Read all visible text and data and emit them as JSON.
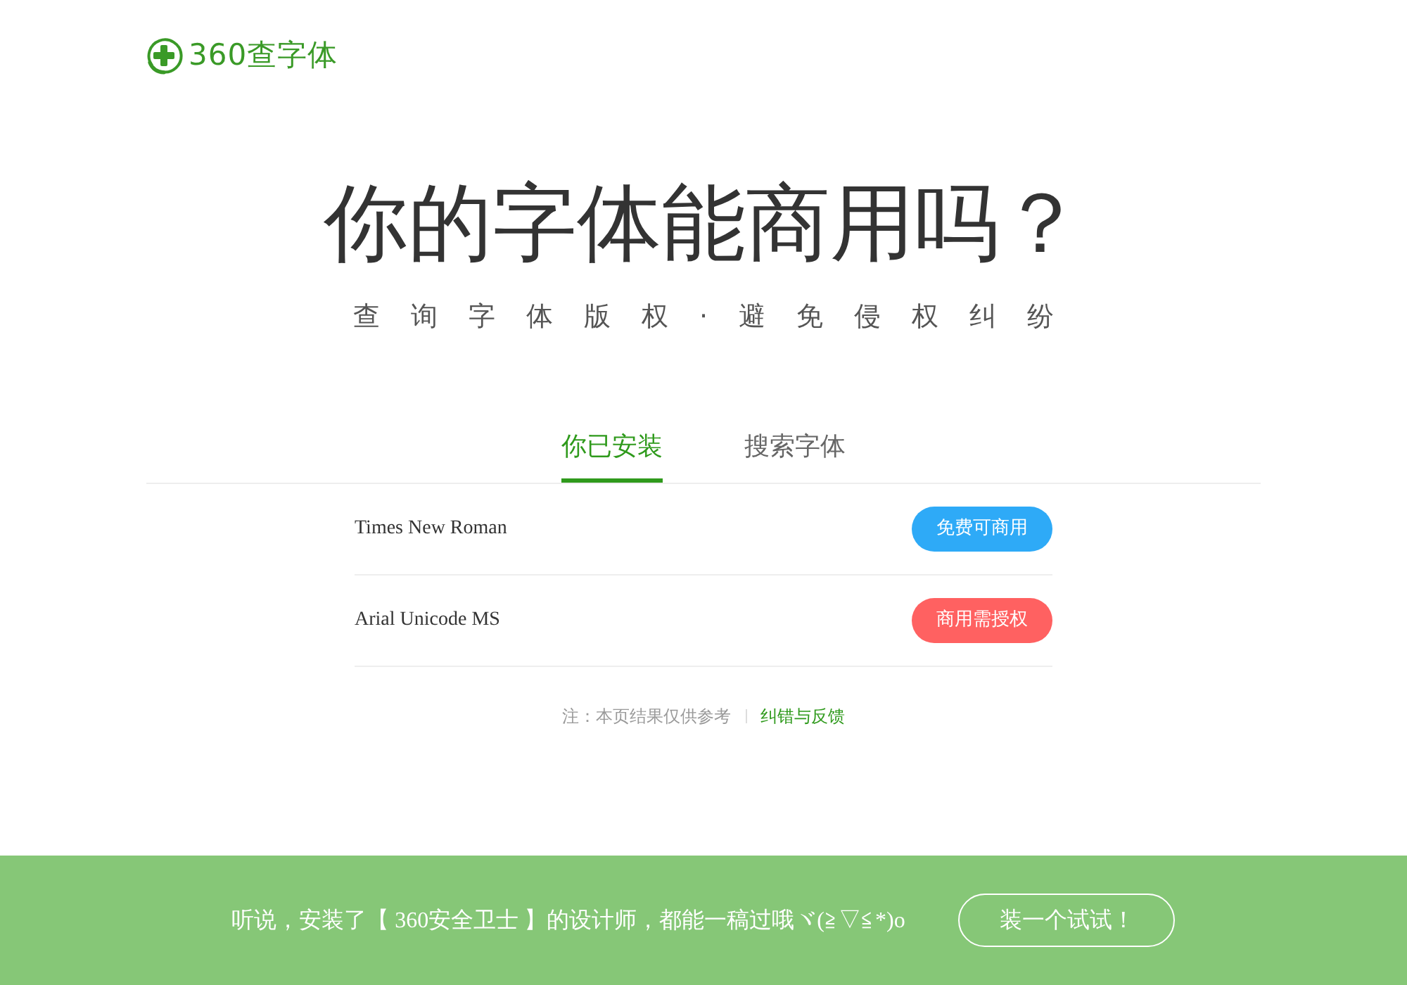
{
  "header": {
    "logo_text": "360查字体"
  },
  "hero": {
    "title": "你的字体能商用吗？",
    "subtitle": "查询字体版权·避免侵权纠纷"
  },
  "tabs": [
    {
      "label": "你已安装",
      "selected": true
    },
    {
      "label": "搜索字体",
      "selected": false
    }
  ],
  "fonts": [
    {
      "name": "Times New Roman",
      "badge": "免费可商用",
      "color": "#2eaaf7"
    },
    {
      "name": "Arial Unicode MS",
      "badge": "商用需授权",
      "color": "#ff6161"
    }
  ],
  "note": {
    "text": "注：本页结果仅供参考",
    "link": "纠错与反馈"
  },
  "footer": {
    "text": "听说，安装了【 360安全卫士 】的设计师，都能一稿过哦ヾ(≧▽≦*)o",
    "button": "装一个试试！"
  }
}
